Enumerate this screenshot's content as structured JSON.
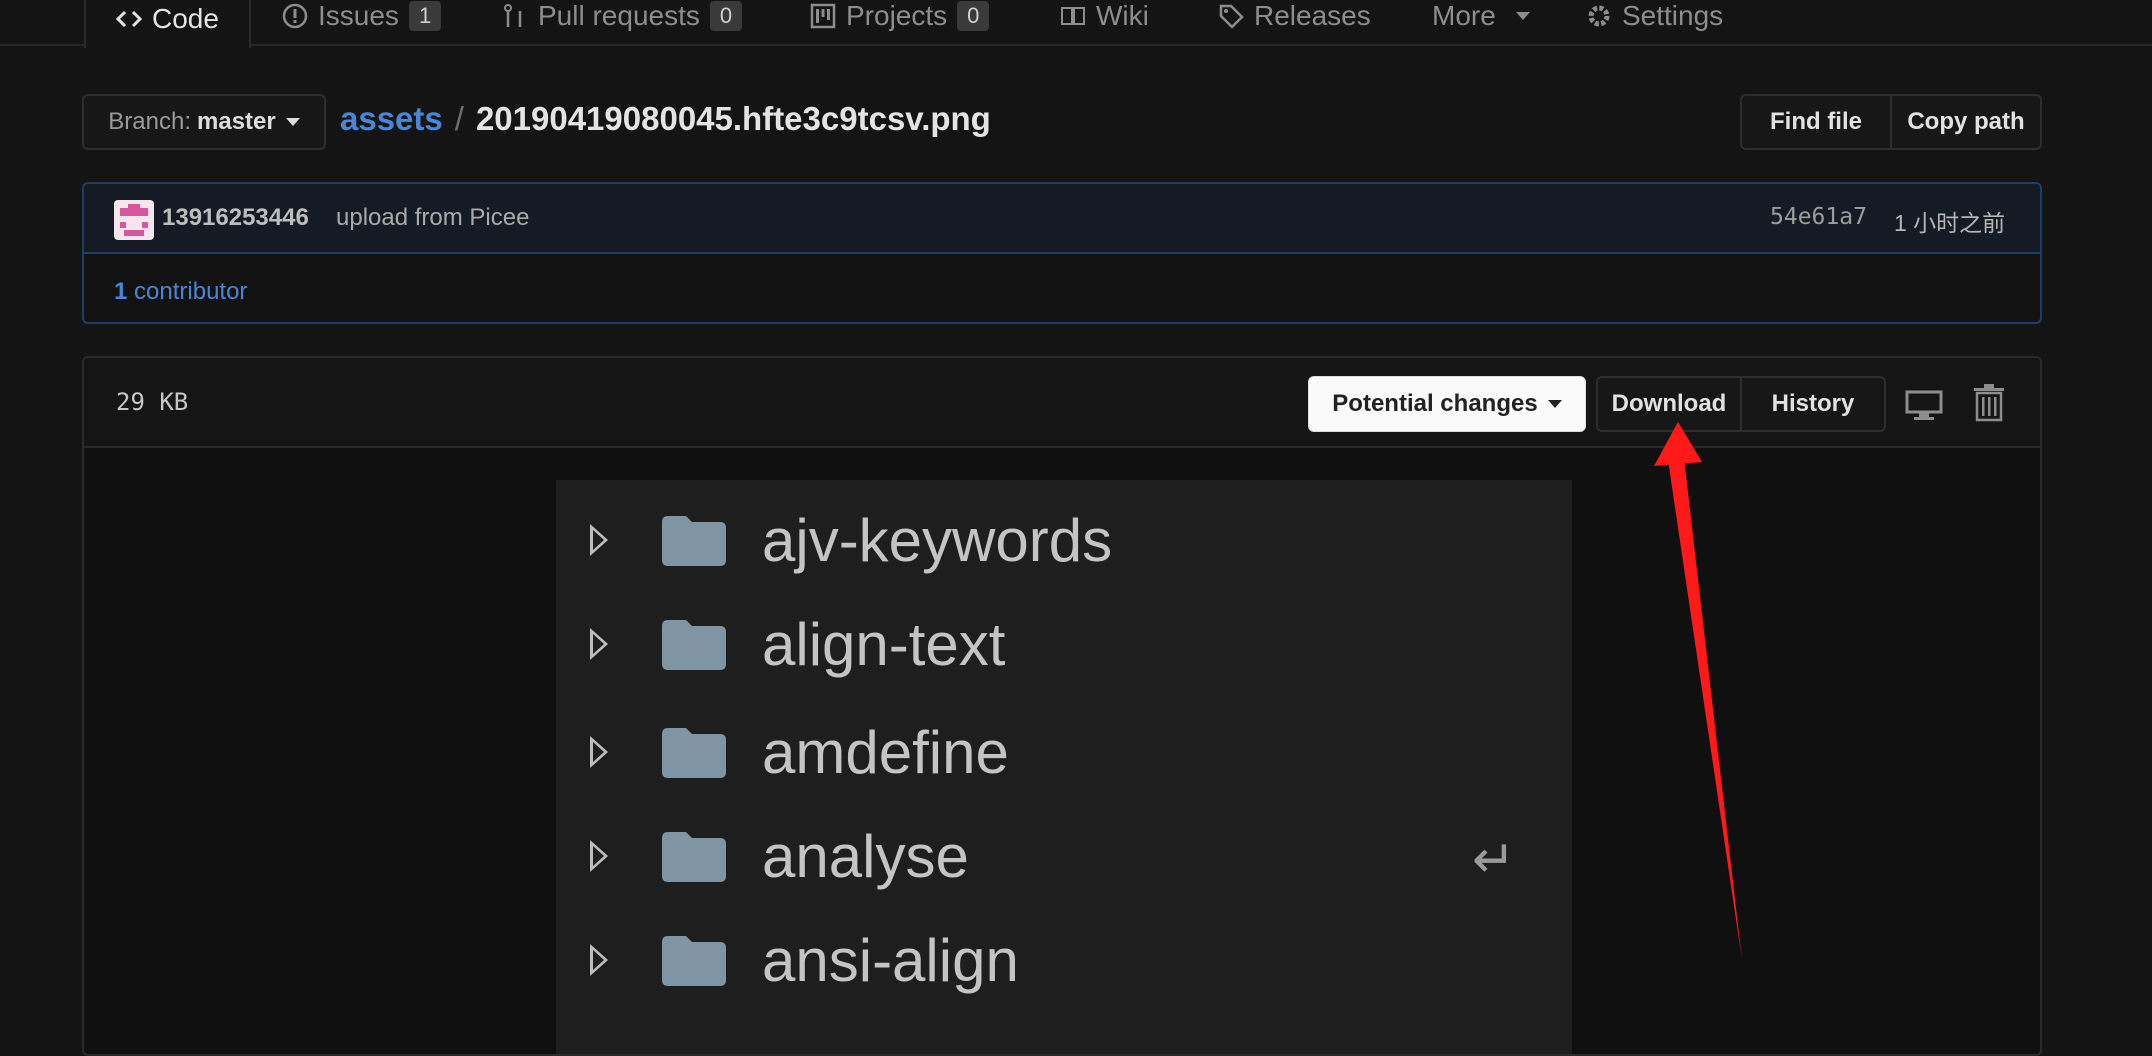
{
  "nav": {
    "tabs": [
      {
        "label": "Code",
        "icon": "code-icon",
        "selected": true
      },
      {
        "label": "Issues",
        "icon": "issue-icon",
        "count": "1"
      },
      {
        "label": "Pull requests",
        "icon": "pull-request-icon",
        "count": "0"
      },
      {
        "label": "Projects",
        "icon": "project-icon",
        "count": "0"
      },
      {
        "label": "Wiki",
        "icon": "book-icon"
      },
      {
        "label": "Releases",
        "icon": "tag-icon"
      },
      {
        "label": "More",
        "icon": "caret-down-icon"
      },
      {
        "label": "Settings",
        "icon": "gear-icon"
      }
    ]
  },
  "branch": {
    "prefix": "Branch:",
    "name": "master"
  },
  "breadcrumb": {
    "dir": "assets",
    "separator": "/",
    "file": "20190419080045.hfte3c9tcsv.png"
  },
  "file_actions": {
    "find_file": "Find file",
    "copy_path": "Copy path"
  },
  "commit": {
    "author": "13916253446",
    "message": "upload from Picee",
    "sha": "54e61a7",
    "time": "1 小时之前",
    "contributor_count": "1",
    "contributor_label": "contributor"
  },
  "file": {
    "size": "29  KB",
    "potential_changes": "Potential changes",
    "download": "Download",
    "history": "History",
    "icons": [
      "desktop-icon",
      "trash-icon"
    ]
  },
  "preview": {
    "rows": [
      {
        "label": "ajv-keywords"
      },
      {
        "label": "align-text"
      },
      {
        "label": "amdefine"
      },
      {
        "label": "analyse",
        "trailing_icon": "↵"
      },
      {
        "label": "ansi-align"
      }
    ]
  },
  "colors": {
    "background": "#141414",
    "link": "#4a86d8",
    "commit_border": "#1f3d66",
    "annotation": "#ff1a1a",
    "folder": "#7f95a3"
  }
}
